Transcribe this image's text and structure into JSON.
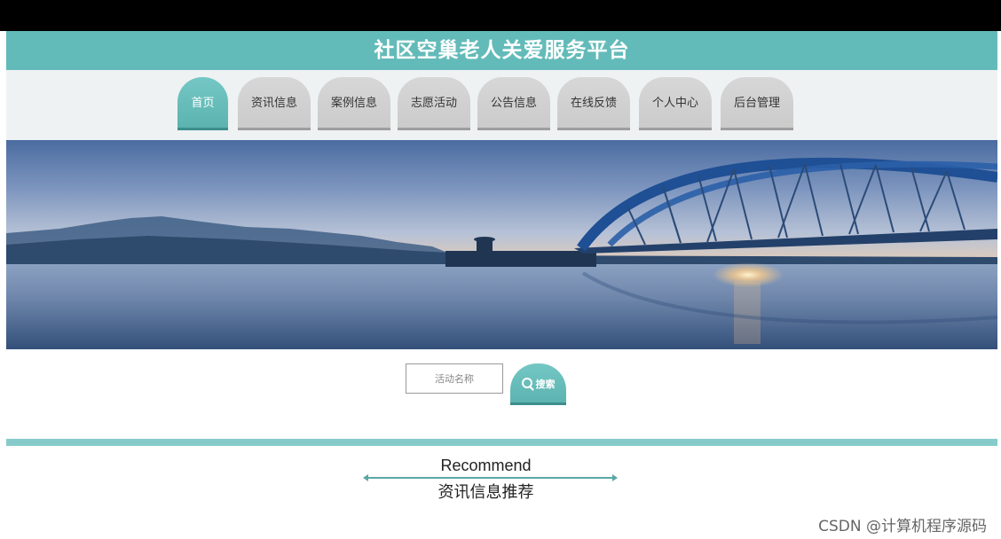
{
  "header": {
    "title": "社区空巢老人关爱服务平台"
  },
  "nav": {
    "items": [
      {
        "label": "首页",
        "active": true
      },
      {
        "label": "资讯信息",
        "active": false
      },
      {
        "label": "案例信息",
        "active": false
      },
      {
        "label": "志愿活动",
        "active": false
      },
      {
        "label": "公告信息",
        "active": false
      },
      {
        "label": "在线反馈",
        "active": false
      },
      {
        "label": "个人中心",
        "active": false
      },
      {
        "label": "后台管理",
        "active": false
      }
    ]
  },
  "search": {
    "placeholder": "活动名称",
    "value": "",
    "button_label": "搜索",
    "button_icon": "search-icon"
  },
  "recommend": {
    "title_en": "Recommend",
    "title_cn": "资讯信息推荐"
  },
  "watermark": "CSDN @计算机程序源码",
  "colors": {
    "accent": "#63bbb9",
    "nav_inactive": "#d0d0d0",
    "divider": "#86cbc9"
  }
}
